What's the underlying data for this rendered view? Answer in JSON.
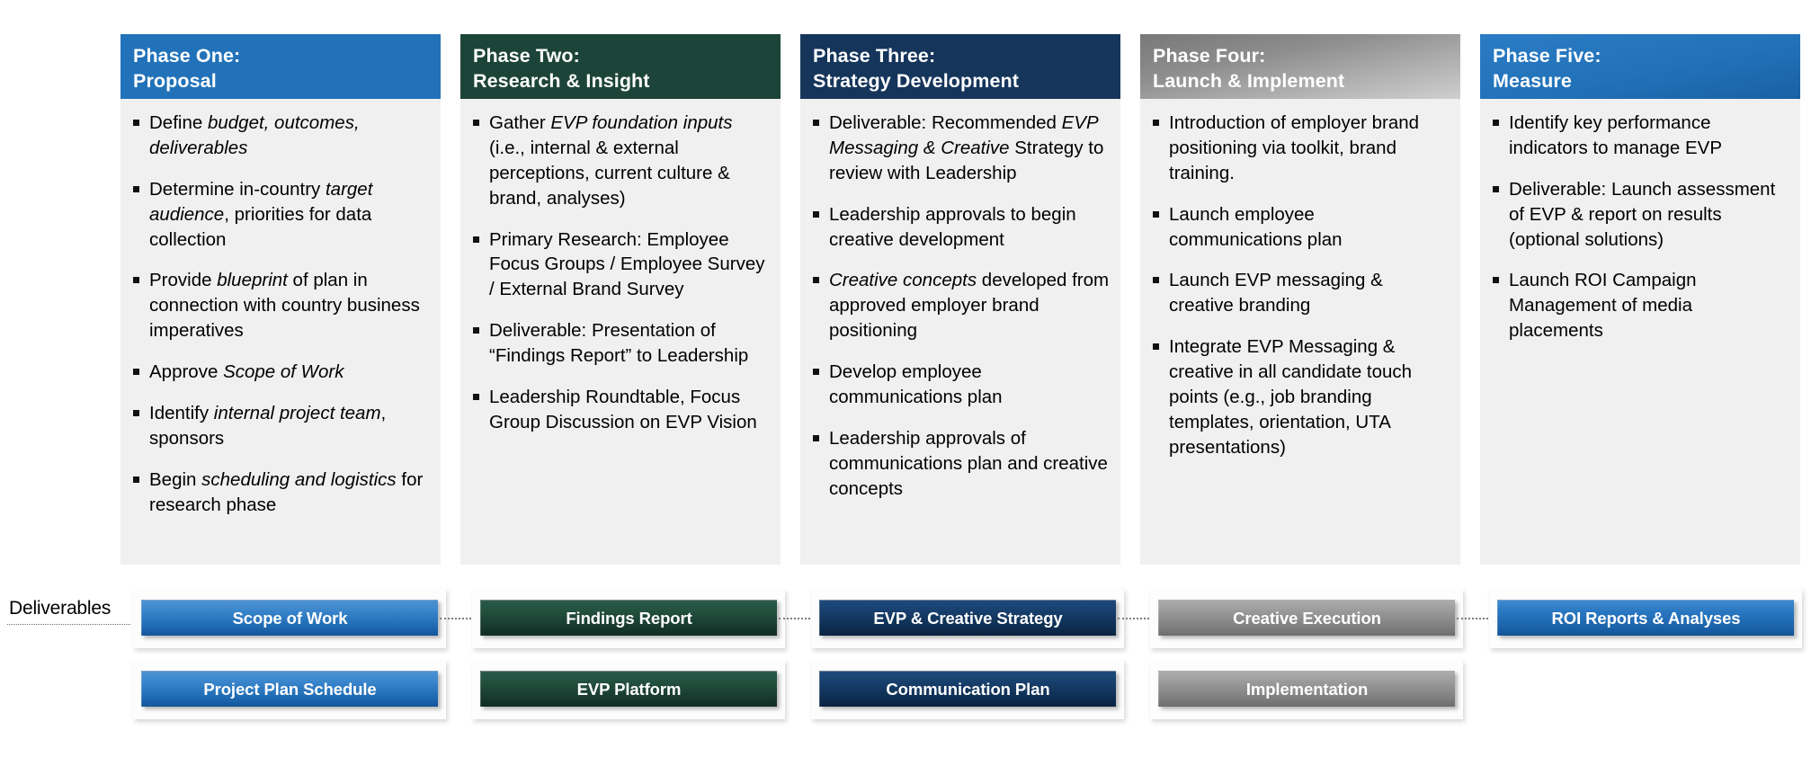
{
  "phases": [
    {
      "title_line1": "Phase One:",
      "title_line2": "Proposal",
      "header_style": "hdr-blue",
      "bullets": [
        [
          {
            "t": "Define ",
            "i": false
          },
          {
            "t": "budget, outcomes, deliverables",
            "i": true
          }
        ],
        [
          {
            "t": "Determine in-country ",
            "i": false
          },
          {
            "t": "target audience",
            "i": true
          },
          {
            "t": ", priorities for data collection",
            "i": false
          }
        ],
        [
          {
            "t": "Provide ",
            "i": false
          },
          {
            "t": "blueprint",
            "i": true
          },
          {
            "t": " of plan in connection with country business imperatives",
            "i": false
          }
        ],
        [
          {
            "t": "Approve ",
            "i": false
          },
          {
            "t": "Scope of Work",
            "i": true
          }
        ],
        [
          {
            "t": "Identify ",
            "i": false
          },
          {
            "t": "internal project team",
            "i": true
          },
          {
            "t": ", sponsors",
            "i": false
          }
        ],
        [
          {
            "t": "Begin ",
            "i": false
          },
          {
            "t": "scheduling and logistics",
            "i": true
          },
          {
            "t": " for research phase",
            "i": false
          }
        ]
      ]
    },
    {
      "title_line1": "Phase Two:",
      "title_line2": "Research & Insight",
      "header_style": "hdr-green",
      "bullets": [
        [
          {
            "t": "Gather ",
            "i": false
          },
          {
            "t": "EVP foundation inputs",
            "i": true
          },
          {
            "t": " (i.e., internal & external perceptions, current culture & brand, analyses)",
            "i": false
          }
        ],
        [
          {
            "t": "Primary Research: Employee Focus Groups / Employee Survey / External Brand Survey",
            "i": false
          }
        ],
        [
          {
            "t": " Deliverable: Presentation of “Findings Report” to Leadership",
            "i": false
          }
        ],
        [
          {
            "t": "Leadership Roundtable, Focus Group Discussion on EVP Vision",
            "i": false
          }
        ]
      ]
    },
    {
      "title_line1": "Phase Three:",
      "title_line2": "Strategy Development",
      "header_style": "hdr-navy",
      "bullets": [
        [
          {
            "t": "Deliverable:  Recommended ",
            "i": false
          },
          {
            "t": "EVP Messaging & Creative",
            "i": true
          },
          {
            "t": " Strategy to review with Leadership",
            "i": false
          }
        ],
        [
          {
            "t": "Leadership approvals to begin creative development",
            "i": false
          }
        ],
        [
          {
            "t": "Creative concepts",
            "i": true
          },
          {
            "t": " developed from approved employer brand positioning",
            "i": false
          }
        ],
        [
          {
            "t": "Develop employee communications plan",
            "i": false
          }
        ],
        [
          {
            "t": "Leadership approvals of communications plan and creative concepts",
            "i": false
          }
        ]
      ]
    },
    {
      "title_line1": "Phase Four:",
      "title_line2": "Launch & Implement",
      "header_style": "hdr-gray",
      "bullets": [
        [
          {
            "t": "Introduction of employer brand positioning via toolkit, brand training.",
            "i": false
          }
        ],
        [
          {
            "t": "Launch employee communications plan",
            "i": false
          }
        ],
        [
          {
            "t": "Launch EVP messaging & creative branding",
            "i": false
          }
        ],
        [
          {
            "t": "Integrate EVP Messaging & creative in all candidate touch points (e.g., job branding templates, orientation, UTA presentations)",
            "i": false
          }
        ]
      ]
    },
    {
      "title_line1": "Phase Five:",
      "title_line2": "Measure",
      "header_style": "hdr-blue5",
      "bullets": [
        [
          {
            "t": "Identify key performance indicators to manage EVP",
            "i": false
          }
        ],
        [
          {
            "t": "Deliverable:  Launch assessment of EVP & report on results (optional solutions)",
            "i": false
          }
        ],
        [
          {
            "t": "Launch ROI Campaign  Management of media placements",
            "i": false
          }
        ]
      ]
    }
  ],
  "deliverables": {
    "label": "Deliverables",
    "row1": [
      {
        "label": "Scope of Work",
        "style": "chip-blue"
      },
      {
        "label": "Findings Report",
        "style": "chip-green"
      },
      {
        "label": "EVP & Creative  Strategy",
        "style": "chip-navy"
      },
      {
        "label": "Creative Execution",
        "style": "chip-gray"
      },
      {
        "label": "ROI Reports & Analyses",
        "style": "chip-blue2"
      }
    ],
    "row2": [
      {
        "label": "Project Plan Schedule",
        "style": "chip-blue"
      },
      {
        "label": "EVP  Platform",
        "style": "chip-green"
      },
      {
        "label": "Communication Plan",
        "style": "chip-navy"
      },
      {
        "label": "Implementation",
        "style": "chip-gray"
      },
      {
        "label": "",
        "style": "chip-blue2"
      }
    ]
  },
  "colors": {
    "phase1": "#2272b9",
    "phase2": "#1d4438",
    "phase3": "#15355b",
    "phase4": "#8d8d8d",
    "phase5": "#2272b9",
    "body_bg": "#f0f0f0",
    "connector": "#7d7d7d"
  }
}
